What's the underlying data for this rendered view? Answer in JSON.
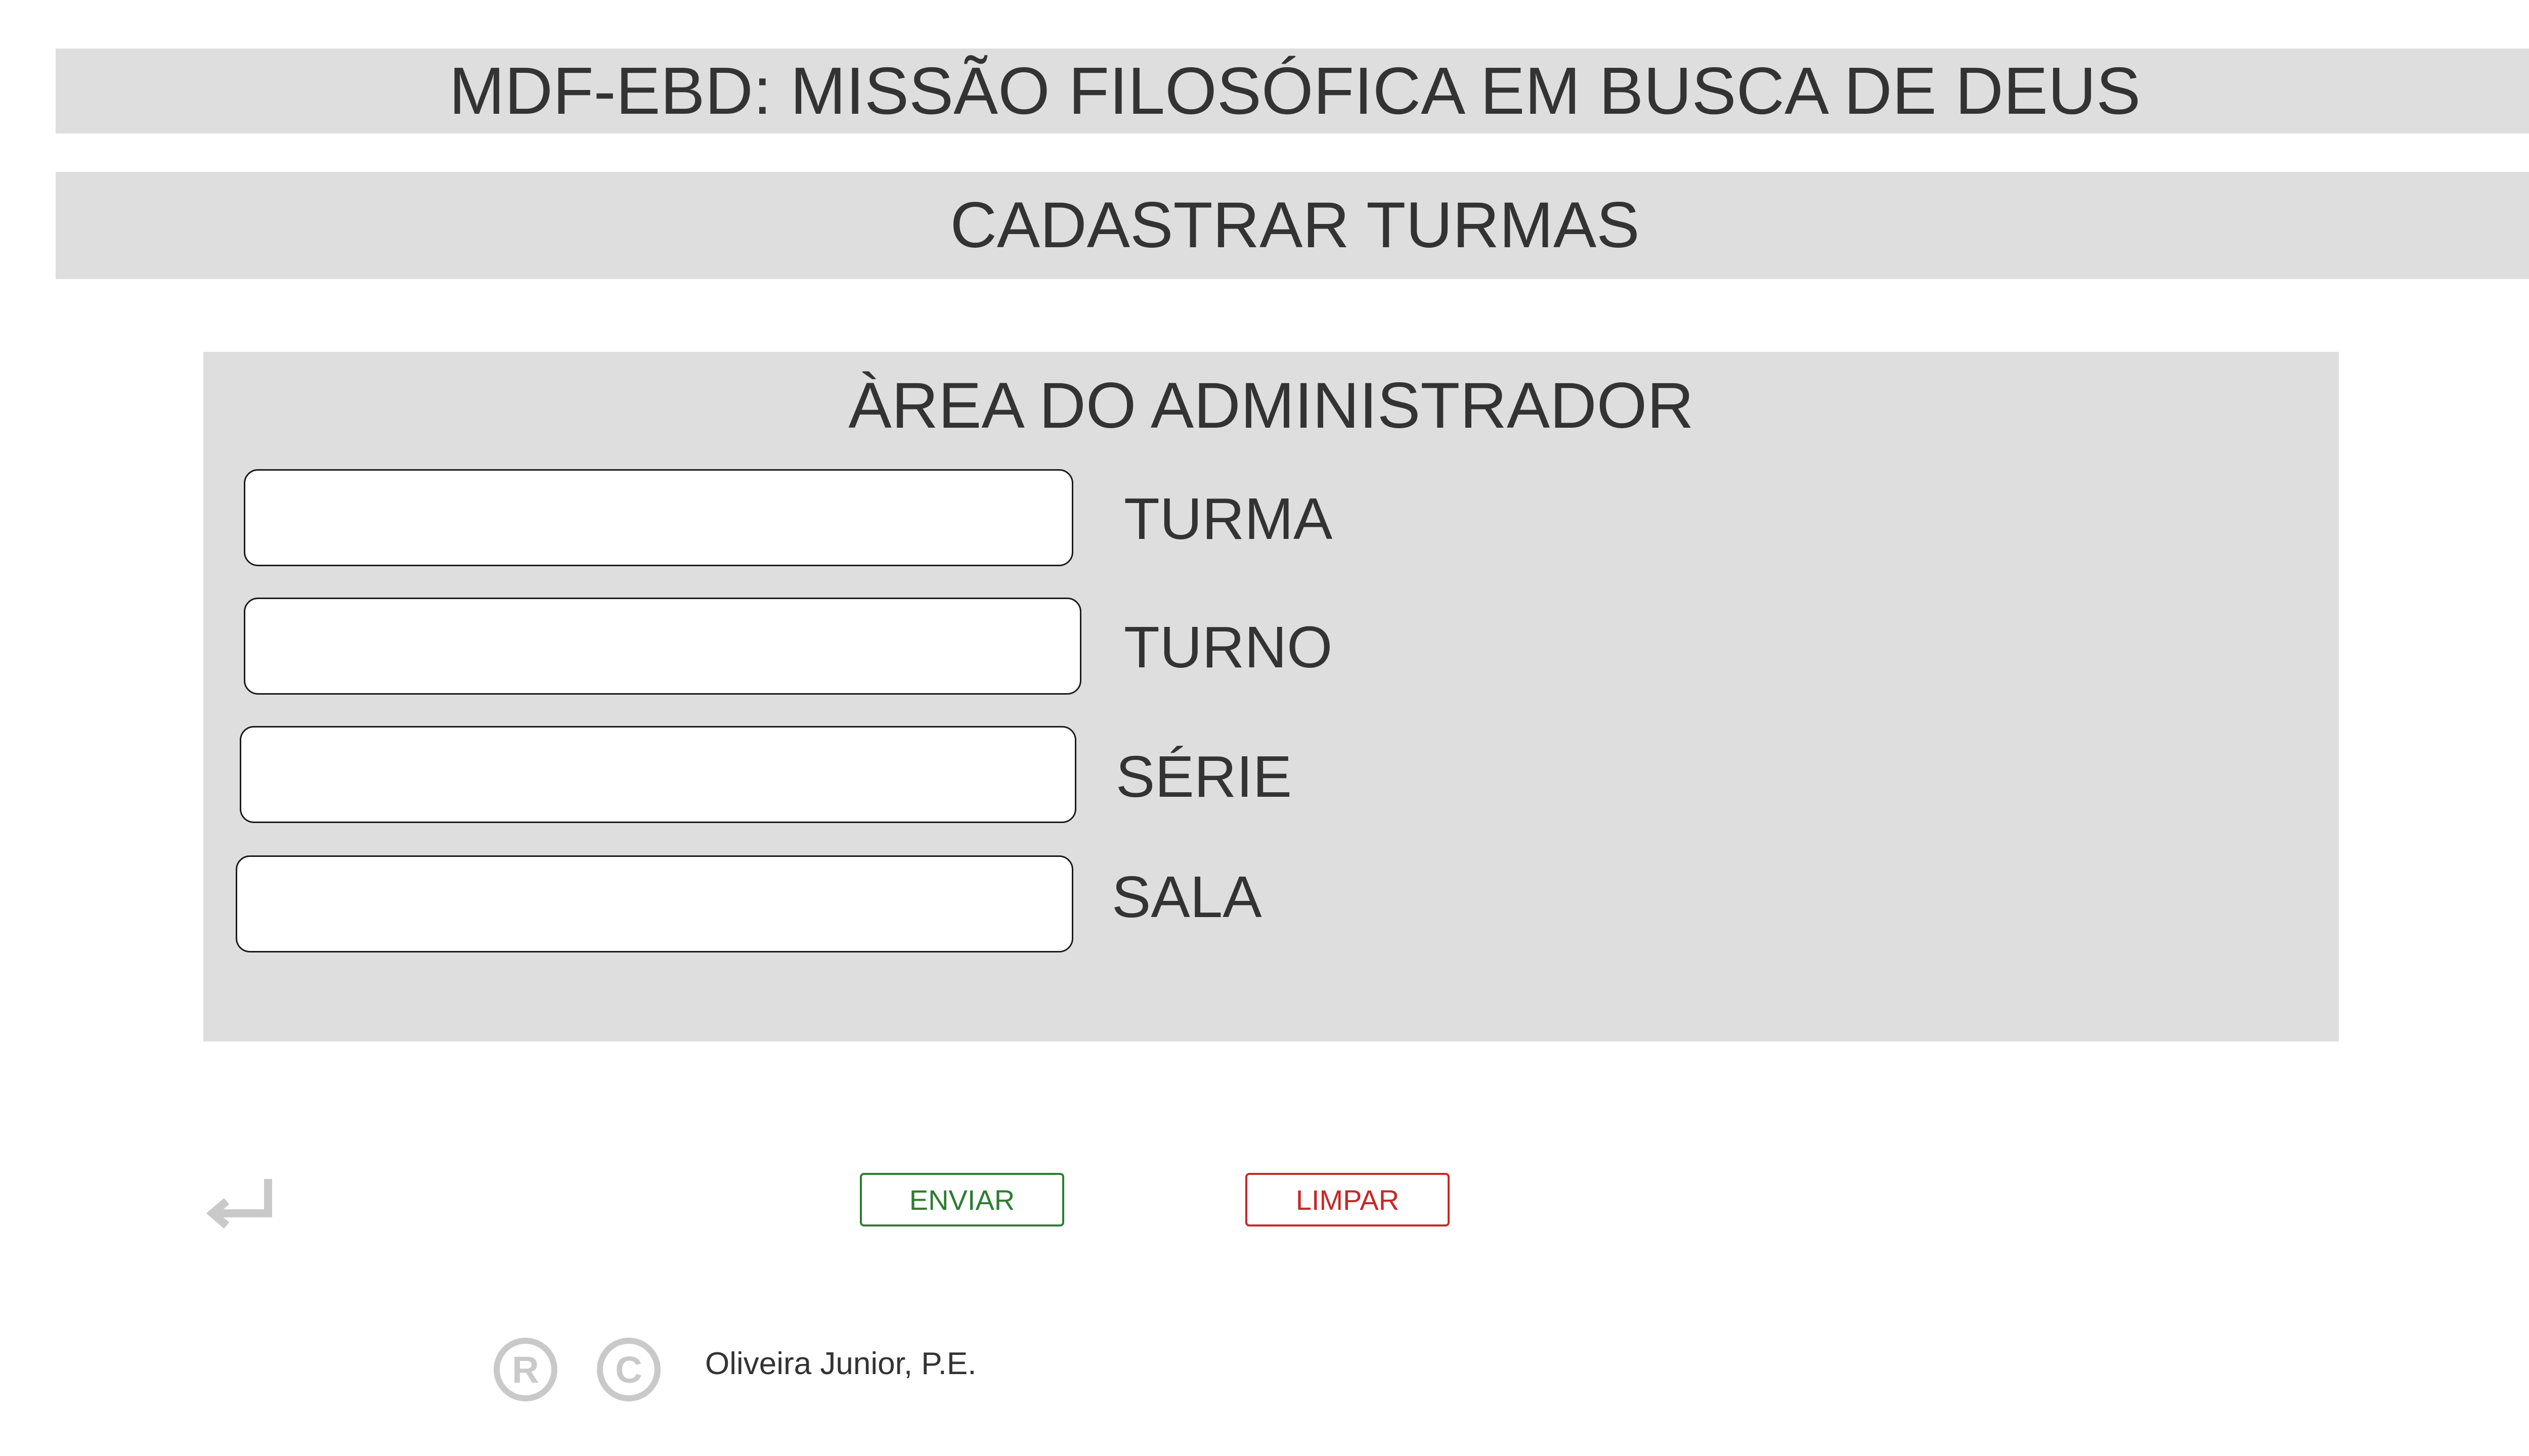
{
  "header": {
    "app_title": "MDF-EBD: MISSÃO FILOSÓFICA EM BUSCA DE DEUS",
    "section_title": "CADASTRAR TURMAS"
  },
  "admin_panel": {
    "title": "ÀREA DO ADMINISTRADOR",
    "fields": [
      {
        "label": "TURMA",
        "value": "",
        "placeholder": ""
      },
      {
        "label": "TURNO",
        "value": "",
        "placeholder": ""
      },
      {
        "label": "SÉRIE",
        "value": "",
        "placeholder": ""
      },
      {
        "label": "SALA",
        "value": "",
        "placeholder": ""
      }
    ]
  },
  "actions": {
    "send_label": "ENVIAR",
    "clear_label": "LIMPAR",
    "back_icon": "return-arrow-icon"
  },
  "footer": {
    "registered_symbol": "R",
    "copyright_symbol": "C",
    "author": "Oliveira Junior, P.E."
  },
  "colors": {
    "bar_background": "#dedede",
    "send_accent": "#2e7d32",
    "clear_accent": "#c62828",
    "icon_gray": "#c9c9c9"
  }
}
